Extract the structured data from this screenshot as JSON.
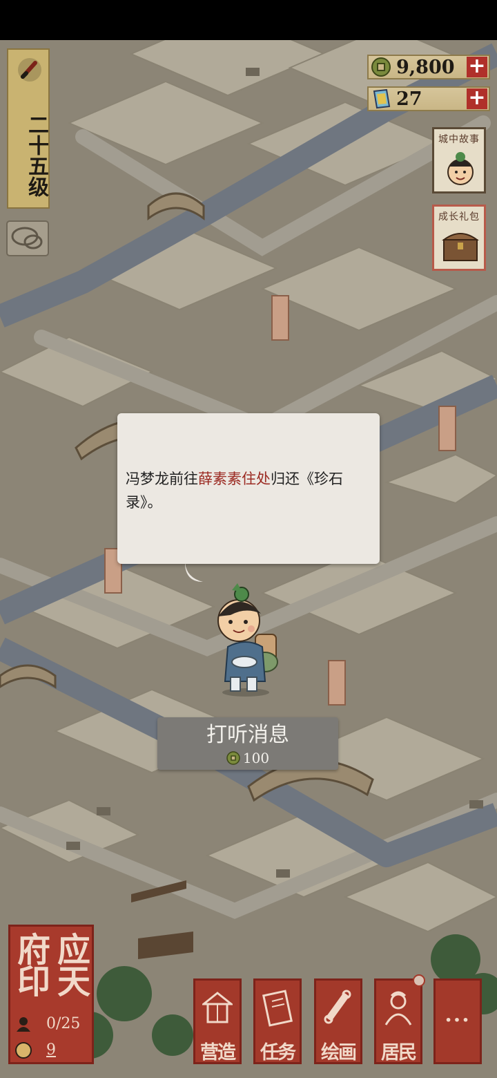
{
  "level": {
    "text": "二十五级"
  },
  "currency": {
    "coins": "9,800",
    "cards": "27"
  },
  "side": {
    "story_label": "城中故事",
    "gift_label": "成长礼包"
  },
  "dialog": {
    "text_before": "冯梦龙前往",
    "text_highlight": "薛素素住处",
    "text_after": "归还《珍石录》。"
  },
  "action": {
    "title": "打听消息",
    "cost": "100"
  },
  "seal": {
    "title": "应天府印",
    "residents": "0/25",
    "count": "9"
  },
  "bottom_nav": {
    "build": "营造",
    "tasks": "任务",
    "paint": "绘画",
    "residents": "居民",
    "more": "···"
  },
  "colors": {
    "accent_red": "#a3392a",
    "gold": "#c9b371",
    "highlight_text": "#9b2a22"
  }
}
